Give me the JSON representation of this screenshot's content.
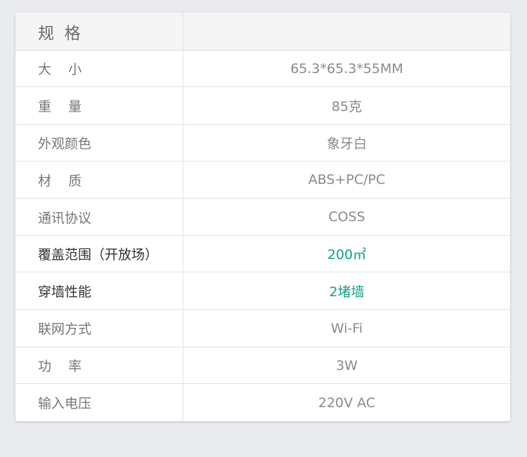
{
  "header": {
    "label": "规  格",
    "value": ""
  },
  "accent_color": "#12a085",
  "rows": [
    {
      "label": "大    小",
      "value": "65.3*65.3*55MM"
    },
    {
      "label": "重    量",
      "value": "85克"
    },
    {
      "label": "外观颜色",
      "value": "象牙白"
    },
    {
      "label": "材    质",
      "value": "ABS+PC/PC"
    },
    {
      "label": "通讯协议",
      "value": "COSS"
    },
    {
      "label": "覆盖范围（开放场）",
      "value": "200㎡"
    },
    {
      "label": "穿墙性能",
      "value": "2堵墙"
    },
    {
      "label": "联网方式",
      "value": "Wi-Fi"
    },
    {
      "label": "功    率",
      "value": "3W"
    },
    {
      "label": "输入电压",
      "value": "220V AC"
    }
  ]
}
